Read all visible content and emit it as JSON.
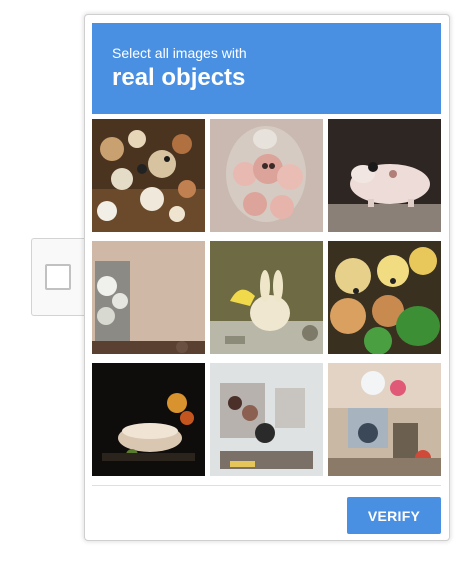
{
  "challenge": {
    "prompt_line1": "Select all images with",
    "prompt_line2": "real objects",
    "verify_label": "VERIFY",
    "accent_color": "#4a90e2"
  },
  "tiles": [
    {
      "subject": "cluttered pile of figurines"
    },
    {
      "subject": "glass dome with pig figurines"
    },
    {
      "subject": "pink pig figurine on table"
    },
    {
      "subject": "wall shelf with dishes"
    },
    {
      "subject": "rabbit-shaped ornament"
    },
    {
      "subject": "floral fabric arrangement"
    },
    {
      "subject": "decorative bowl on dark table"
    },
    {
      "subject": "cluttered shop shelf"
    },
    {
      "subject": "room interior with ornaments"
    }
  ]
}
